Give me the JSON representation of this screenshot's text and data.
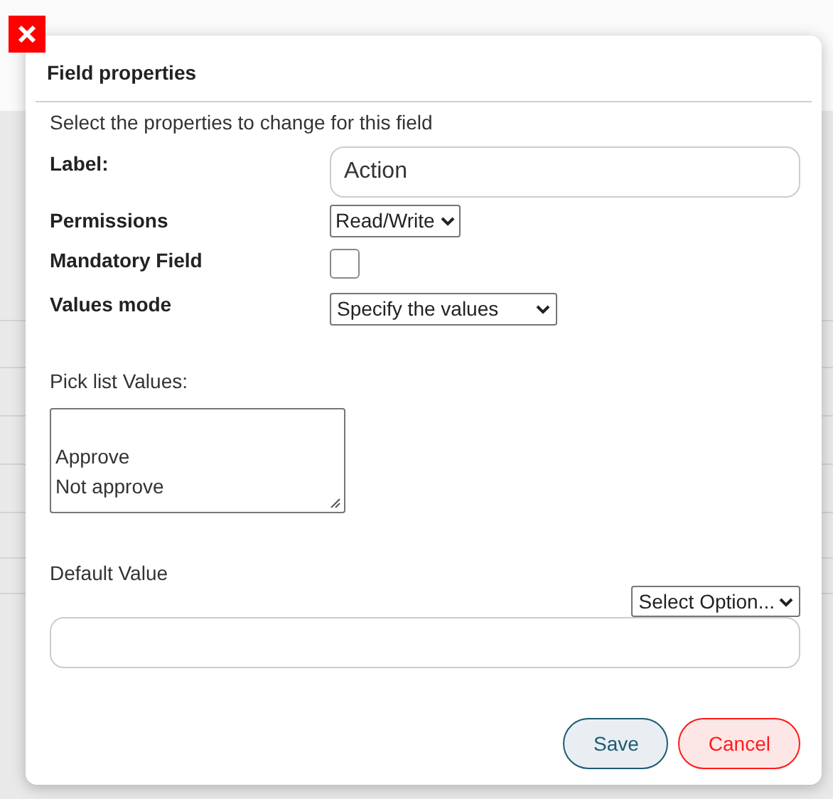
{
  "dialog": {
    "title": "Field properties",
    "intro": "Select the properties to change for this field",
    "label_field": {
      "label": "Label:",
      "value": "Action"
    },
    "permissions": {
      "label": "Permissions",
      "value": "Read/Write"
    },
    "mandatory": {
      "label": "Mandatory Field",
      "checked": false
    },
    "values_mode": {
      "label": "Values mode",
      "value": "Specify the values"
    },
    "pick_list": {
      "label": "Pick list Values:",
      "lines": [
        "Approve",
        "Not approve"
      ]
    },
    "default_value": {
      "label": "Default Value",
      "select": "Select Option..."
    },
    "buttons": [
      {
        "label": "Save",
        "kind": "primary"
      },
      {
        "label": "Cancel",
        "kind": "danger"
      }
    ]
  }
}
